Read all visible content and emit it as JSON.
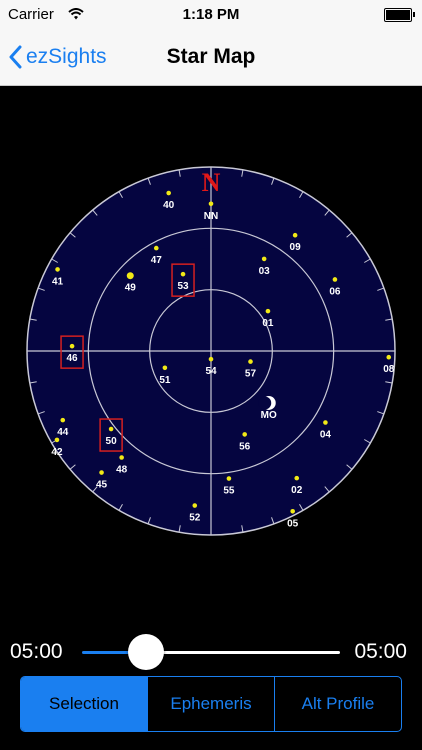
{
  "status_bar": {
    "carrier": "Carrier",
    "time": "1:18 PM"
  },
  "nav": {
    "back_label": "ezSights",
    "title": "Star Map"
  },
  "star_map": {
    "north_label": "N",
    "colors": {
      "background": "#050540",
      "ring": "#c9c9d6",
      "satellite": "#f2ea16",
      "label": "#ffffff",
      "highlight_box": "#d42020",
      "north": "#e01818"
    },
    "satellites": [
      {
        "id": "40",
        "az": 345,
        "el": 10
      },
      {
        "id": "NN",
        "az": 0,
        "el": 18
      },
      {
        "id": "09",
        "az": 36,
        "el": 20
      },
      {
        "id": "47",
        "az": 332,
        "el": 33
      },
      {
        "id": "03",
        "az": 30,
        "el": 38
      },
      {
        "id": "41",
        "az": 298,
        "el": 5
      },
      {
        "id": "49",
        "az": 313,
        "el": 36
      },
      {
        "id": "53",
        "az": 340,
        "el": 50,
        "highlight": true
      },
      {
        "id": "06",
        "az": 60,
        "el": 20
      },
      {
        "id": "01",
        "az": 55,
        "el": 56
      },
      {
        "id": "46",
        "az": 272,
        "el": 22,
        "highlight": true
      },
      {
        "id": "08",
        "az": 92,
        "el": 3
      },
      {
        "id": "57",
        "az": 105,
        "el": 70
      },
      {
        "id": "51",
        "az": 250,
        "el": 66
      },
      {
        "id": "54",
        "az": 180,
        "el": 86
      },
      {
        "id": "MO",
        "az": 132,
        "el": 52,
        "moon": true
      },
      {
        "id": "44",
        "az": 245,
        "el": 10
      },
      {
        "id": "04",
        "az": 122,
        "el": 24
      },
      {
        "id": "42",
        "az": 240,
        "el": 3
      },
      {
        "id": "50",
        "az": 232,
        "el": 28,
        "highlight": true
      },
      {
        "id": "56",
        "az": 158,
        "el": 46
      },
      {
        "id": "45",
        "az": 222,
        "el": 10
      },
      {
        "id": "48",
        "az": 220,
        "el": 22
      },
      {
        "id": "02",
        "az": 146,
        "el": 15
      },
      {
        "id": "55",
        "az": 172,
        "el": 27
      },
      {
        "id": "52",
        "az": 186,
        "el": 14
      },
      {
        "id": "05",
        "az": 153,
        "el": 2
      }
    ]
  },
  "timeline": {
    "start": "05:00",
    "end": "05:00",
    "position": 0.25,
    "track_filled": "#1a7ff0",
    "track_empty": "#ffffff"
  },
  "segments": {
    "selected": "Selection",
    "items": [
      "Selection",
      "Ephemeris",
      "Alt Profile"
    ]
  }
}
